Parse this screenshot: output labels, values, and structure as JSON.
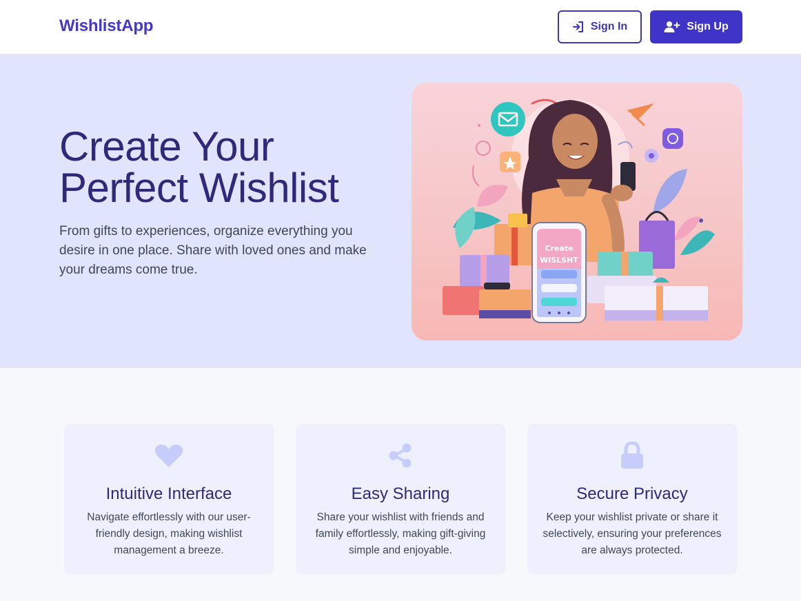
{
  "header": {
    "logo": "WishlistApp",
    "signin_label": "Sign In",
    "signup_label": "Sign Up",
    "signin_icon": "sign-in-icon",
    "signup_icon": "user-plus-icon"
  },
  "hero": {
    "title_line1": "Create Your",
    "title_line2": "Perfect Wishlist",
    "subtitle": "From gifts to experiences, organize everything you desire in one place. Share with loved ones and make your dreams come true.",
    "illustration": {
      "phone_line1": "Create",
      "phone_line2": "WISLSHT"
    }
  },
  "features": [
    {
      "icon": "heart-icon",
      "title": "Intuitive Interface",
      "description": "Navigate effortlessly with our user-friendly design, making wishlist management a breeze."
    },
    {
      "icon": "share-icon",
      "title": "Easy Sharing",
      "description": "Share your wishlist with friends and family effortlessly, making gift-giving simple and enjoyable."
    },
    {
      "icon": "lock-icon",
      "title": "Secure Privacy",
      "description": "Keep your wishlist private or share it selectively, ensuring your preferences are always protected."
    }
  ],
  "colors": {
    "brand": "#4338ca",
    "hero_bg": "#e0e4fd",
    "card_bg": "#eef0fd",
    "icon": "#c7cdfa",
    "title": "#2e2a7a"
  }
}
